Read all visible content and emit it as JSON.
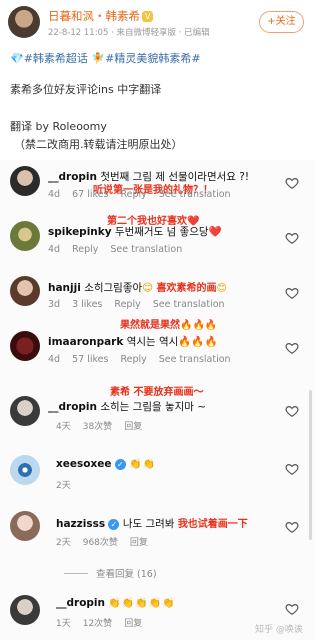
{
  "post": {
    "author": "日暮和沨・韩素希",
    "vip_badge": "V",
    "meta": "22-8-12 11:05 · 来自微博轻享版 · 已编辑",
    "follow_label": "+关注",
    "tags": {
      "diamond": "💎",
      "topic1": "#韩素希超话",
      "fairy": "🧚",
      "topic2": "#精灵美貌韩素希#"
    },
    "line1": "素希多位好友评论ins 中字翻译",
    "line2": "翻译 by Roleoomy",
    "line3": "（禁二改商用.转载请注明原出处）"
  },
  "comments": [
    {
      "user": "__dropin",
      "text": "첫번째 그림 제 선물이라면서요 ?!",
      "meta": [
        "4d",
        "67 likes",
        "Reply",
        "See translation"
      ],
      "translation": "听说第一张是我的礼物？！"
    },
    {
      "user": "spikepinky",
      "text": "두번째거도 넘 좋으당",
      "emoji": "❤️",
      "meta": [
        "4d",
        "Reply",
        "See translation"
      ],
      "translation": "第二个我也好喜欢",
      "translation_emoji": "❤️"
    },
    {
      "user": "hanjji",
      "text": "소히그림좋아",
      "emoji": "😊",
      "meta": [
        "3d",
        "3 likes",
        "Reply",
        "See translation"
      ],
      "translation": "喜欢素希的画",
      "translation_emoji": "😊"
    },
    {
      "user": "imaaronpark",
      "text": "역시는 역시",
      "emoji": "🔥🔥🔥",
      "meta": [
        "4d",
        "57 likes",
        "Reply",
        "See translation"
      ],
      "translation": "果然就是果然",
      "translation_emoji": "🔥🔥🔥"
    },
    {
      "user": "__dropin",
      "text": "소히는 그림을 놓지마 ~",
      "meta": [
        "4天",
        "38次赞",
        "回复"
      ],
      "translation": "素希 不要放弃画画～"
    },
    {
      "user": "xeesoxee",
      "emoji": "👏👏",
      "meta": [
        "2天"
      ]
    },
    {
      "user": "hazzisss",
      "text": "나도 그려봐",
      "translation": "我也试着画一下",
      "meta": [
        "2天",
        "968次赞",
        "回复"
      ],
      "view_replies": "查看回复 (16)"
    },
    {
      "user": "__dropin",
      "emoji": "👏👏👏👏👏",
      "meta": [
        "1天",
        "12次赞",
        "回复"
      ]
    }
  ],
  "verified_mark": "✓",
  "watermark": "知乎 @唤诶",
  "colors": {
    "accent": "#e86a1a",
    "topic": "#3a6ea8",
    "translation": "#e8301a",
    "verified": "#3897f0"
  }
}
